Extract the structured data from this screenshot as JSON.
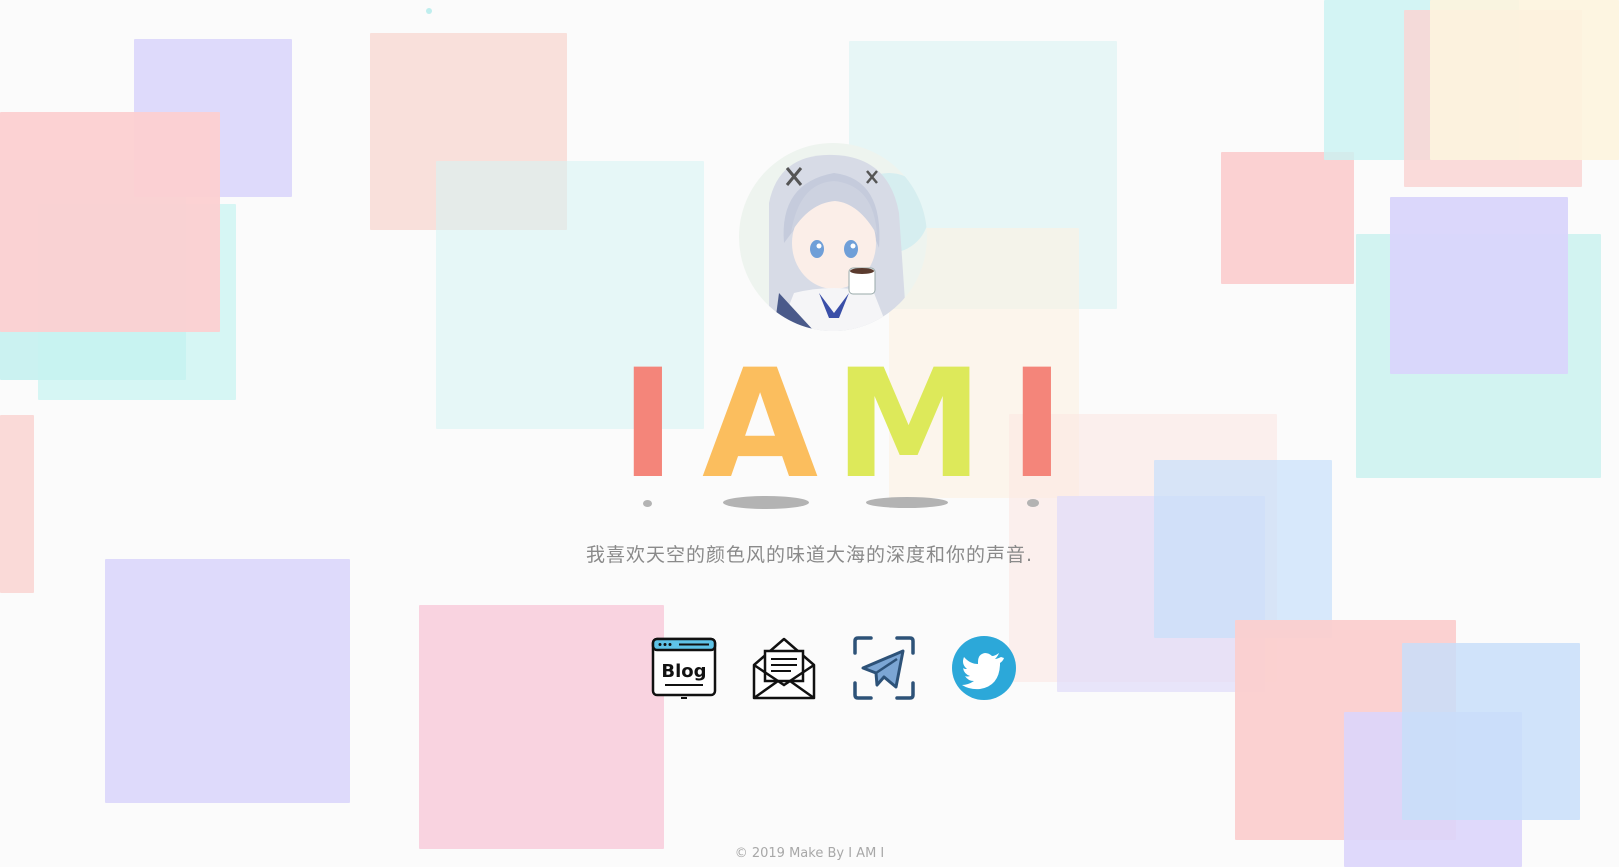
{
  "header": {
    "title_letters": [
      {
        "char": "I",
        "color": "#f4857a"
      },
      {
        "char": "A",
        "color": "#fbbe5e"
      },
      {
        "char": "M",
        "color": "#dde95a"
      },
      {
        "char": "I",
        "color": "#f4857a"
      }
    ]
  },
  "tagline": "我喜欢天空的颜色风的味道大海的深度和你的声音.",
  "social": {
    "blog_label": "Blog",
    "items": [
      {
        "name": "blog",
        "icon": "blog-icon"
      },
      {
        "name": "email",
        "icon": "envelope-icon"
      },
      {
        "name": "telegram",
        "icon": "telegram-icon",
        "color": "#2d5278"
      },
      {
        "name": "twitter",
        "icon": "twitter-icon",
        "color": "#2ca8d9"
      }
    ]
  },
  "footer": {
    "copyright": "© 2019 Make By I AM I"
  }
}
